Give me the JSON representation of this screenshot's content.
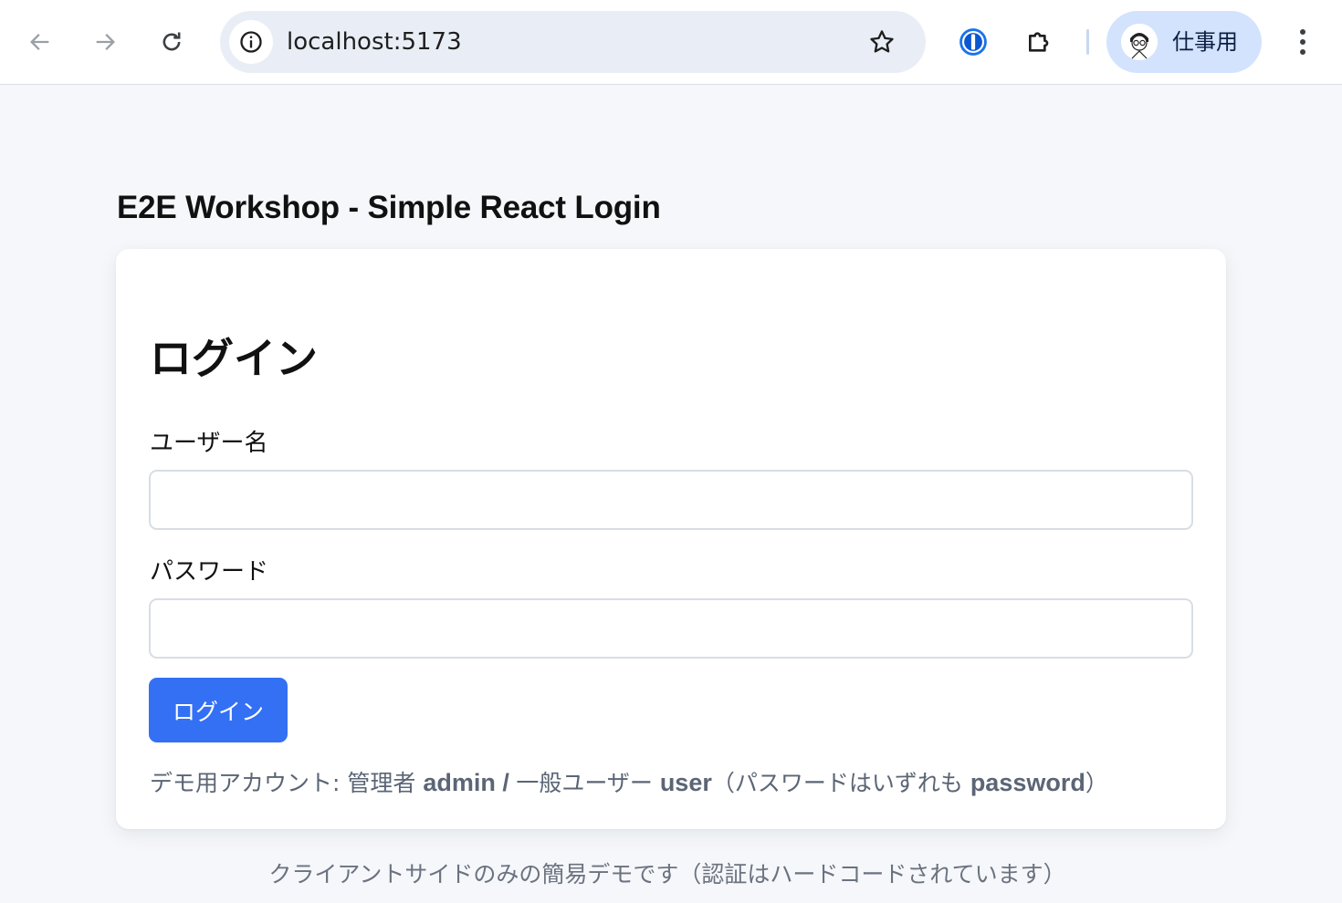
{
  "browser": {
    "url": "localhost:5173",
    "profile_name": "仕事用",
    "icons": {
      "back": "arrow-left-icon",
      "forward": "arrow-right-icon",
      "reload": "reload-icon",
      "site_info": "info-icon",
      "bookmark": "star-icon",
      "password_manager": "1password-icon",
      "extensions": "puzzle-icon",
      "menu": "kebab-menu-icon"
    }
  },
  "page": {
    "app_title": "E2E Workshop - Simple React Login",
    "card_title": "ログイン",
    "username_label": "ユーザー名",
    "username_value": "",
    "password_label": "パスワード",
    "password_value": "",
    "login_button": "ログイン",
    "hint": {
      "prefix": "デモ用アカウント: 管理者 ",
      "admin": "admin",
      "sep": " / ",
      "general_label": "一般ユーザー ",
      "user": "user",
      "password_prefix": "（パスワードはいずれも ",
      "password": "password",
      "suffix": "）"
    },
    "footer_note": "クライアントサイドのみの簡易デモです（認証はハードコードされています）"
  },
  "colors": {
    "primary": "#3370f4",
    "page_bg": "#f5f7fa",
    "omnibox_bg": "#e9eef6",
    "profile_bg": "#d3e3fd"
  }
}
